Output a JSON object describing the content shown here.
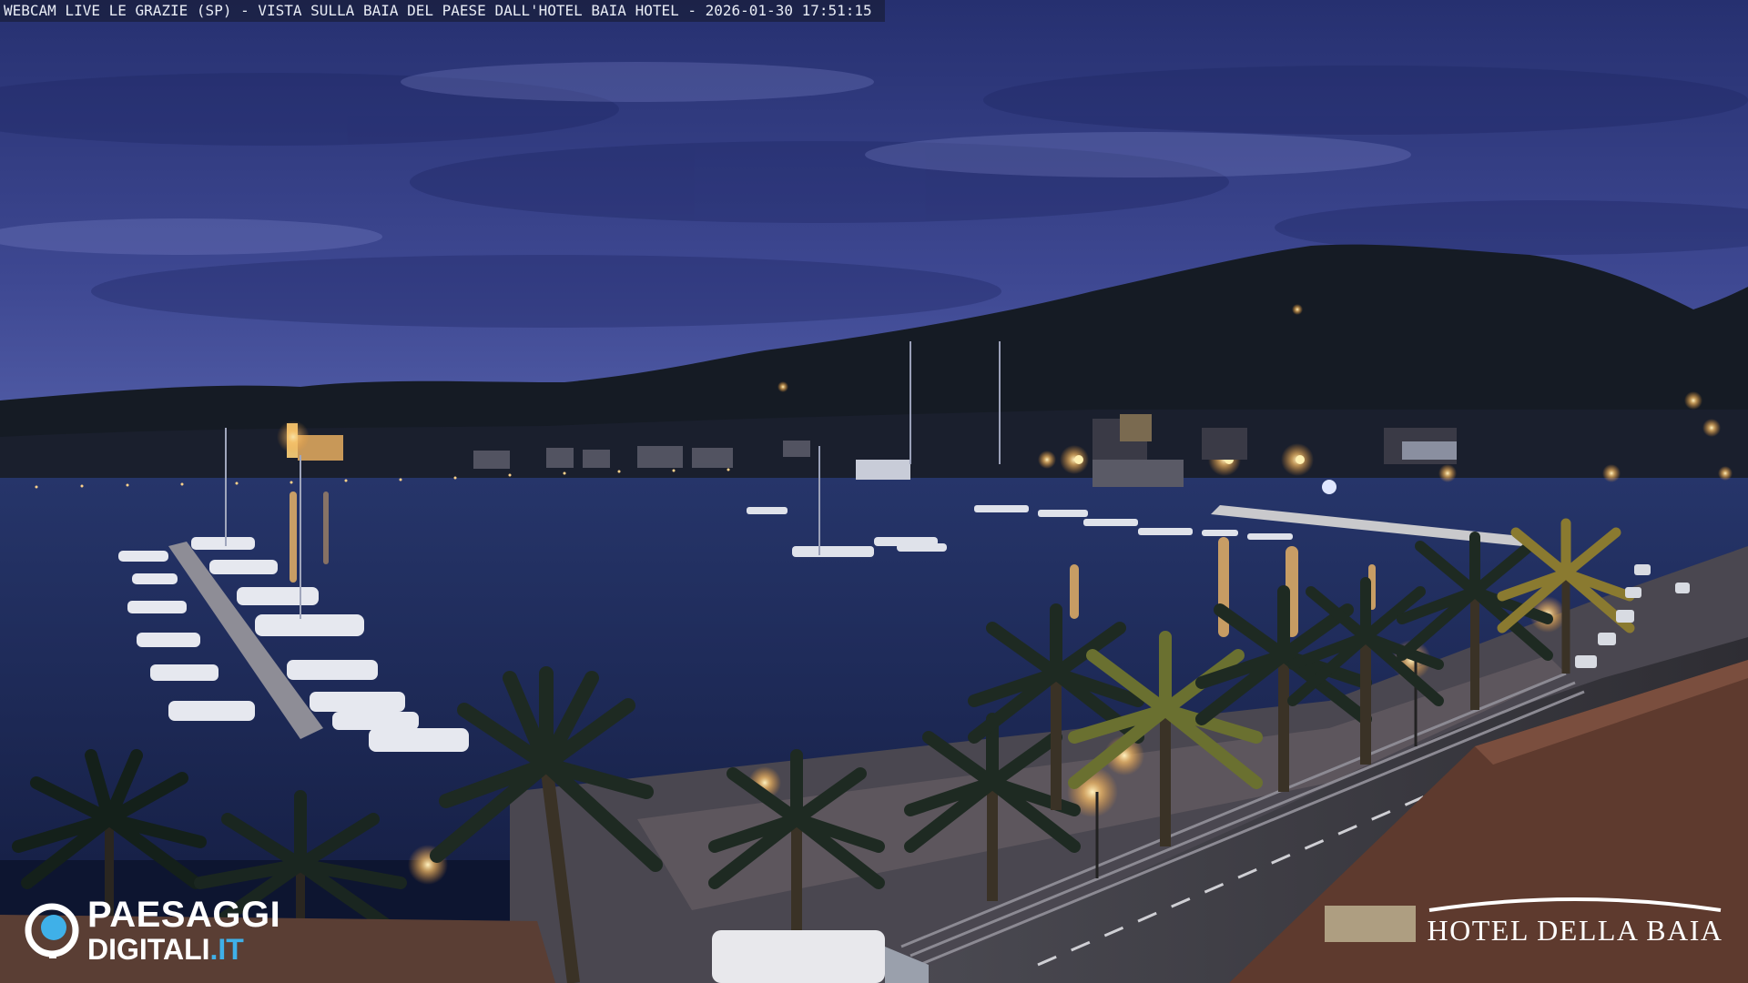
{
  "overlay": {
    "caption": "WEBCAM LIVE LE GRAZIE (SP) - VISTA SULLA BAIA DEL PAESE DALL'HOTEL BAIA HOTEL - 2026-01-30 17:51:15"
  },
  "watermark": {
    "brand_line1": "PAESAGGI",
    "brand_line2_prefix": "DIGITALI",
    "brand_line2_suffix": ".IT",
    "brand_accent_color": "#3fb0e8",
    "hotel_name": "HOTEL DELLA BAIA"
  },
  "scene": {
    "time_of_day": "dusk",
    "colors": {
      "sky_top": "#2a3575",
      "sky_bottom": "#5a66b0",
      "hills": "#141a22",
      "water": "#1d2a55",
      "lights": "#ffc266"
    }
  }
}
